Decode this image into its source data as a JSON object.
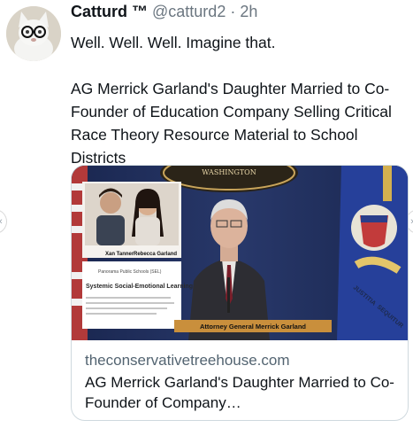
{
  "tweet": {
    "display_name": "Catturd ™",
    "handle": "@catturd2",
    "separator": "·",
    "time": "2h",
    "lines": [
      "Well. Well. Well. Imagine that.",
      "AG Merrick Garland's Daughter Married to Co-Founder of Education Company Selling Critical Race Theory Resource Material to School Districts"
    ]
  },
  "card": {
    "domain": "theconservativetreehouse.com",
    "title": "AG Merrick Garland's Daughter Married to Co-Founder of Company…",
    "image": {
      "seal_text": "WASHINGTON",
      "caption": "Attorney General Merrick Garland",
      "inset_names": [
        "Xan Tanner",
        "Rebecca Garland"
      ],
      "doc_logo": "Panorama Public Schools (SEL)",
      "doc_heading": "Systemic Social-Emotional Learning",
      "flag_text_1": "JUSTITIA",
      "flag_text_2": "SEQUITUR"
    }
  },
  "nav": {
    "prev_icon": "chevron-left-icon",
    "next_icon": "chevron-right-icon"
  },
  "colors": {
    "text": "#0f1419",
    "secondary": "#536471",
    "border": "#cfd9de",
    "backdrop": "#1d2a4e"
  }
}
